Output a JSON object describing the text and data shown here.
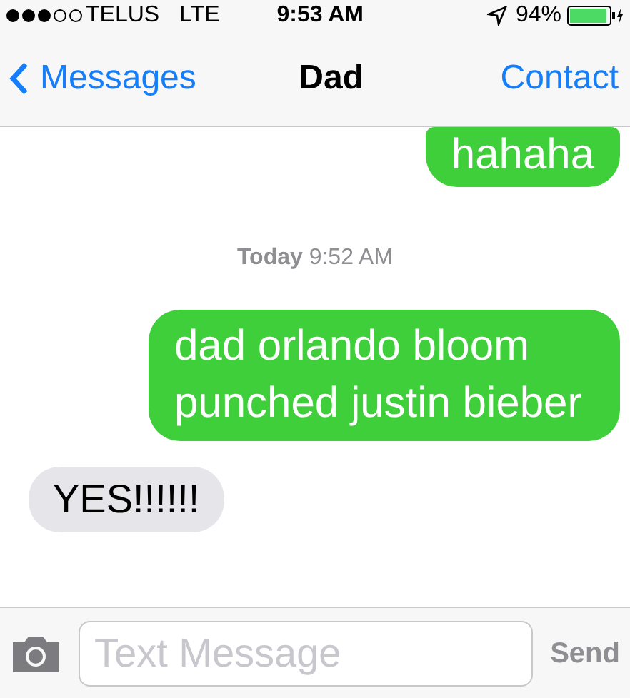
{
  "status_bar": {
    "carrier": "TELUS",
    "network": "LTE",
    "time": "9:53 AM",
    "battery": "94%",
    "battery_meter": {
      "level": 0.94
    }
  },
  "nav": {
    "back": "Messages",
    "title": "Dad",
    "action": "Contact"
  },
  "messages": [
    {
      "kind": "sent",
      "text": "hahaha"
    },
    {
      "kind": "timestamp",
      "text": "**Today** 9:52 AM"
    },
    {
      "kind": "sent",
      "text": "dad orlando bloom punched justin bieber"
    },
    {
      "kind": "received",
      "text": "YES!!!!!!"
    }
  ],
  "composer": {
    "placeholder": "Text Message",
    "send": "Send",
    "send_disabled": true
  }
}
